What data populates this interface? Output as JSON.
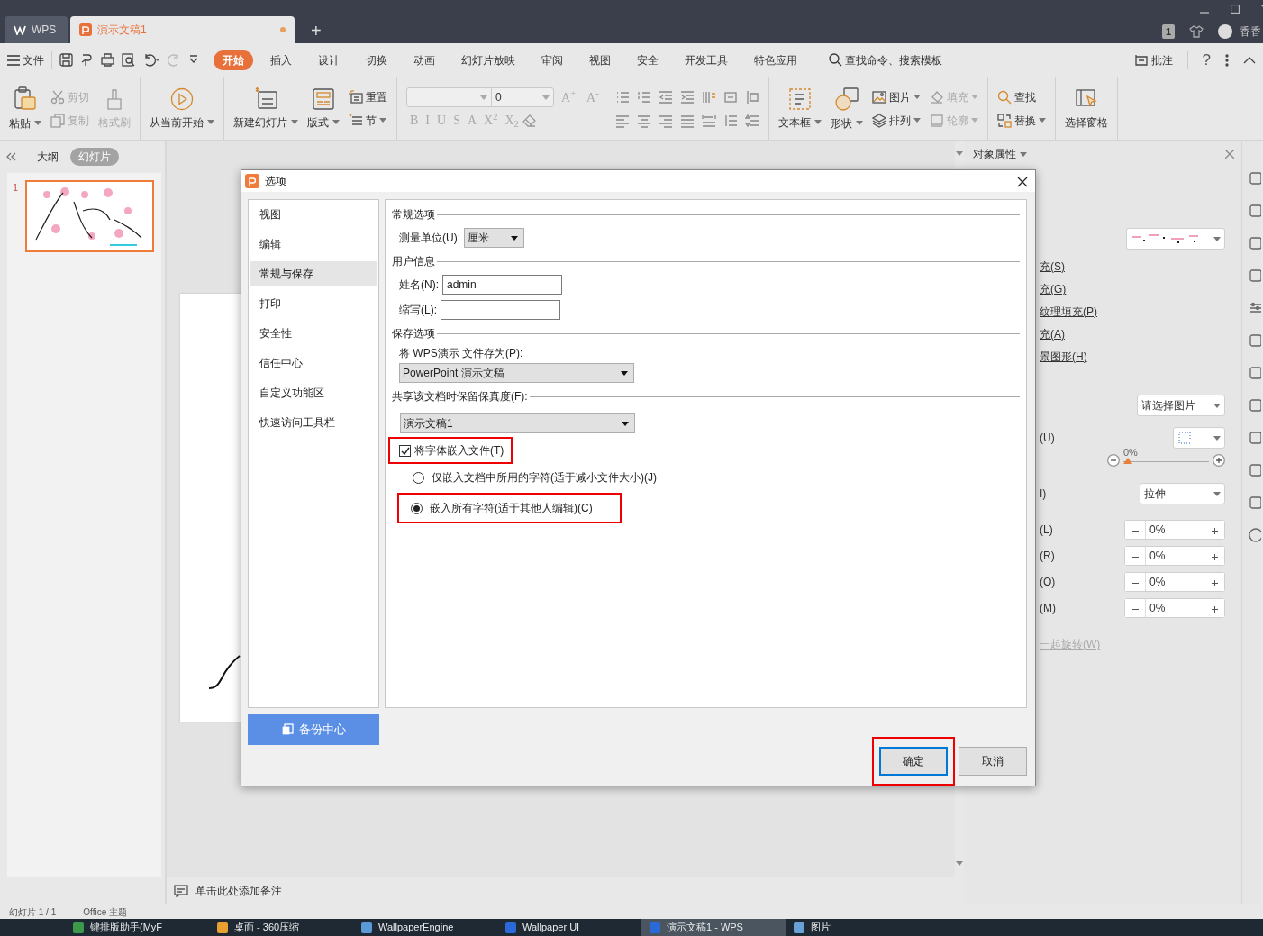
{
  "tabs": [
    {
      "label": "WPS",
      "kind": "home",
      "selected": false
    },
    {
      "label": "演示文稿1",
      "kind": "document",
      "selected": true,
      "modified": true
    }
  ],
  "new_tab": "+",
  "account": {
    "badge": "1",
    "name": "香香"
  },
  "menu": {
    "file": "文件",
    "items": [
      {
        "label": "开始",
        "selected": true
      },
      {
        "label": "插入",
        "selected": false
      },
      {
        "label": "设计",
        "selected": false
      },
      {
        "label": "切换",
        "selected": false
      },
      {
        "label": "动画",
        "selected": false
      },
      {
        "label": "幻灯片放映",
        "selected": false
      },
      {
        "label": "审阅",
        "selected": false
      },
      {
        "label": "视图",
        "selected": false
      },
      {
        "label": "安全",
        "selected": false
      },
      {
        "label": "开发工具",
        "selected": false
      },
      {
        "label": "特色应用",
        "selected": false
      }
    ],
    "search": "查找命令、搜索模板",
    "comment": "批注",
    "help": "?"
  },
  "ribbon": {
    "paste": {
      "label": "粘贴",
      "disabled": false
    },
    "cut": {
      "label": "剪切",
      "disabled": true
    },
    "copy": {
      "label": "复制",
      "disabled": true
    },
    "format_painter": {
      "label": "格式刷",
      "disabled": true
    },
    "play": {
      "label": "从当前开始",
      "disabled": false
    },
    "new_slide": {
      "label": "新建幻灯片",
      "disabled": false
    },
    "layout": {
      "label": "版式",
      "disabled": false
    },
    "reset": {
      "label": "重置",
      "disabled": false
    },
    "section": {
      "label": "节",
      "disabled": false
    },
    "font_size": "0",
    "grow": "A$^{+}$",
    "shrink": "A$^{-}$",
    "font_format": [
      "B",
      "I",
      "U",
      "S",
      "A",
      "X$^{2}$",
      "X$_{2}$"
    ],
    "textbox": {
      "label": "文本框",
      "disabled": false
    },
    "shape": {
      "label": "形状",
      "disabled": false
    },
    "picture": {
      "label": "图片",
      "disabled": false
    },
    "fill": {
      "label": "填充",
      "disabled": true
    },
    "arrange": {
      "label": "排列",
      "disabled": false
    },
    "outline": {
      "label": "轮廓",
      "disabled": true
    },
    "find": {
      "label": "查找",
      "disabled": false
    },
    "replace": {
      "label": "替换",
      "disabled": false
    },
    "selection_pane": {
      "label": "选择窗格",
      "disabled": false
    }
  },
  "left_panel": {
    "tabs": [
      {
        "label": "大纲",
        "selected": false
      },
      {
        "label": "幻灯片",
        "selected": true
      }
    ],
    "slides": [
      {
        "number": "1",
        "selected": true
      }
    ]
  },
  "notes": "单击此处添加备注",
  "properties_panel": {
    "title": "对象属性",
    "fill_labels": [
      "充(S)",
      "充(G)",
      "纹理填充(P)",
      "充(A)",
      "景图形(H)"
    ],
    "picture_choice": "请选择图片",
    "pattern_label": "(U)",
    "transparency": {
      "reading": "0%",
      "level": 0
    },
    "stretch_label": "I)",
    "stretch": "拉伸",
    "offsets": [
      {
        "label": "(L)",
        "value": "0%"
      },
      {
        "label": "(R)",
        "value": "0%"
      },
      {
        "label": "(O)",
        "value": "0%"
      },
      {
        "label": "(M)",
        "value": "0%"
      }
    ],
    "rotate": {
      "label": "一起旋转(W)",
      "disabled": true
    }
  },
  "dialog": {
    "title": "选项",
    "nav": [
      {
        "label": "视图",
        "selected": false
      },
      {
        "label": "编辑",
        "selected": false
      },
      {
        "label": "常规与保存",
        "selected": true
      },
      {
        "label": "打印",
        "selected": false
      },
      {
        "label": "安全性",
        "selected": false
      },
      {
        "label": "信任中心",
        "selected": false
      },
      {
        "label": "自定义功能区",
        "selected": false
      },
      {
        "label": "快速访问工具栏",
        "selected": false
      }
    ],
    "backup": "备份中心",
    "general": {
      "heading": "常规选项",
      "unit_label": "测量单位(U):",
      "unit": "厘米"
    },
    "user": {
      "heading": "用户信息",
      "name_label": "姓名(N):",
      "name": "admin",
      "initials_label": "缩写(L):"
    },
    "save": {
      "heading": "保存选项",
      "format_label": "将 WPS演示 文件存为(P):",
      "format": "PowerPoint 演示文稿"
    },
    "fidelity": {
      "heading": "共享该文档时保留保真度(F):",
      "document": "演示文稿1",
      "embed_fonts": {
        "label": "将字体嵌入文件(T)",
        "checked": true,
        "highlighted": true
      },
      "options": [
        {
          "label": "仅嵌入文档中所用的字符(适于减小文件大小)(J)",
          "selected": false,
          "highlighted": false
        },
        {
          "label": "嵌入所有字符(适于其他人编辑)(C)",
          "selected": true,
          "highlighted": true
        }
      ]
    },
    "buttons": [
      {
        "label": "确定",
        "default": true,
        "highlighted": true
      },
      {
        "label": "取消",
        "default": false,
        "highlighted": false
      }
    ]
  },
  "status_bar": [
    "幻灯片 1 / 1",
    "Office 主题"
  ],
  "taskbar": [
    {
      "label": "键排版助手(MyF",
      "selected": false
    },
    {
      "label": "桌面 - 360压缩",
      "selected": false
    },
    {
      "label": "WallpaperEngine",
      "selected": false
    },
    {
      "label": "Wallpaper UI",
      "selected": false
    },
    {
      "label": "演示文稿1 - WPS",
      "selected": true
    },
    {
      "label": "图片",
      "selected": false
    }
  ]
}
